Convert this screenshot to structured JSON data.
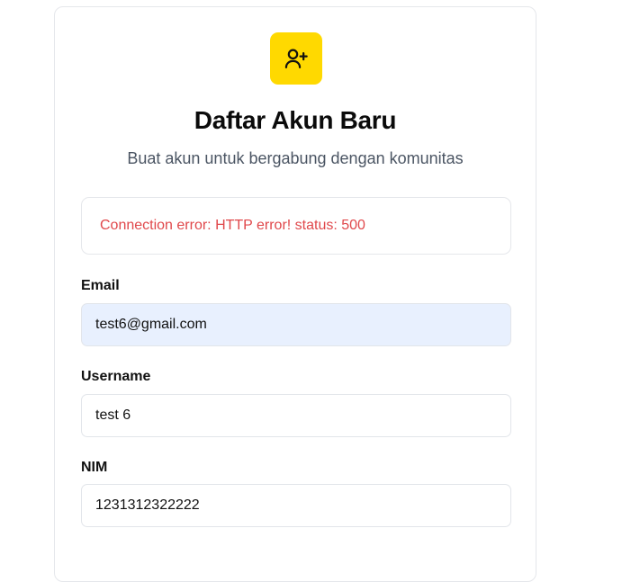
{
  "header": {
    "icon": "user-plus-icon",
    "accent_color": "#FFD900",
    "title": "Daftar Akun Baru",
    "subtitle": "Buat akun untuk bergabung dengan komunitas"
  },
  "error": {
    "message": "Connection error: HTTP error! status: 500",
    "color": "#E0484B"
  },
  "form": {
    "email": {
      "label": "Email",
      "value": "test6@gmail.com"
    },
    "username": {
      "label": "Username",
      "value": "test 6"
    },
    "nim": {
      "label": "NIM",
      "value": "1231312322222"
    }
  }
}
